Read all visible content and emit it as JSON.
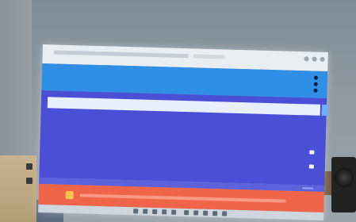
{
  "window": {
    "title": ""
  },
  "list": {
    "items": [
      {
        "label": "",
        "value": "",
        "selected": true
      },
      {
        "label": "",
        "value": "",
        "selected": false
      },
      {
        "label": "",
        "value": "",
        "selected": false
      },
      {
        "label": "",
        "value": "",
        "selected": false
      },
      {
        "label": "",
        "value": "",
        "selected": false
      }
    ]
  },
  "banner": {
    "text": "",
    "icon": "warning-icon"
  },
  "colors": {
    "header": "#2f8fe6",
    "list_background": "#4a4fd6",
    "banner": "#f0654a",
    "selected_row": "#e8f0ff"
  }
}
